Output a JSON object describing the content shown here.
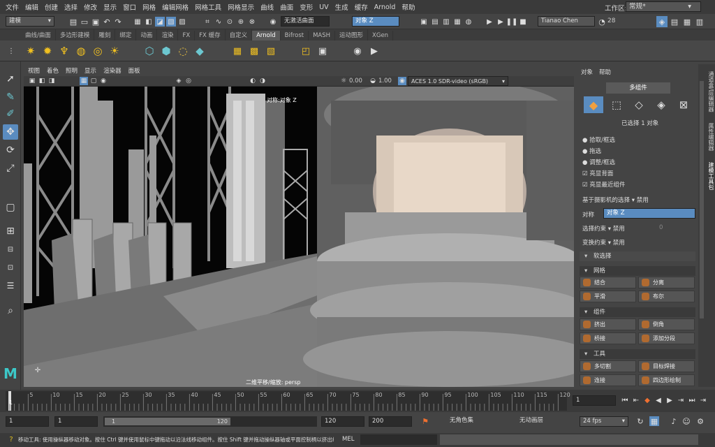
{
  "menubar": {
    "items": [
      "文件",
      "编辑",
      "创建",
      "选择",
      "修改",
      "显示",
      "窗口",
      "网格",
      "编辑网格",
      "网格工具",
      "网格显示",
      "曲线",
      "曲面",
      "变形",
      "UV",
      "生成",
      "缓存",
      "Arnold",
      "帮助"
    ],
    "workspace_label": "工作区:",
    "workspace_value": "常规*"
  },
  "statusline": {
    "mode_dropdown": "建模",
    "live_surface": "无激活曲面",
    "symmetry_field": "对象 Z",
    "user": "Tianao Chen",
    "notifications": "28"
  },
  "shelf": {
    "tabs": [
      "曲线/曲面",
      "多边形建模",
      "雕刻",
      "绑定",
      "动画",
      "渲染",
      "FX",
      "FX 缓存",
      "自定义",
      "Arnold",
      "Bifrost",
      "MASH",
      "运动图形",
      "XGen"
    ],
    "active_tab": "Arnold"
  },
  "viewport": {
    "menus": [
      "视图",
      "着色",
      "照明",
      "显示",
      "渲染器",
      "面板"
    ],
    "exposure": "0.00",
    "gamma": "1.00",
    "color_space": "ACES 1.0 SDR-video (sRGB)",
    "hud_top": "对称:对象 Z",
    "hud_bottom": "二维平移/缩放: persp"
  },
  "attr": {
    "menus": [
      "对象",
      "帮助"
    ],
    "component_tab": "多组件",
    "selected_text": "已选择 1 对象",
    "options": [
      "拾取/框选",
      "拖选",
      "调整/框选"
    ],
    "checks": [
      "亮显背面",
      "亮显最近组件"
    ],
    "camera_based": "基于摄影机的选择",
    "disabled": "禁用",
    "symmetry_label": "对称",
    "symmetry_value": "对象 Z",
    "sel_constraint": "选择约束",
    "xform_constraint": "变换约束",
    "zero": "0",
    "soft_select": "软选择",
    "mesh_section": "网格",
    "mesh_btns": [
      "结合",
      "分离",
      "平滑",
      "布尔"
    ],
    "comp_section": "组件",
    "comp_btns": [
      "挤出",
      "倒角",
      "桥接",
      "添加分段"
    ],
    "tool_section": "工具",
    "tool_btns": [
      "多切割",
      "目标焊接",
      "连接",
      "四边形绘制"
    ]
  },
  "rightstrip": {
    "tabs": [
      "建模工具包",
      "属性编辑器",
      "通道盒/层编辑器"
    ]
  },
  "timeline": {
    "ticks": [
      "5",
      "10",
      "15",
      "20",
      "25",
      "30",
      "35",
      "40",
      "45",
      "50",
      "55",
      "60",
      "65",
      "70",
      "75",
      "80",
      "85",
      "90",
      "95",
      "100",
      "105",
      "110",
      "115",
      "120"
    ],
    "start_marker": "1",
    "current_frame": "1"
  },
  "range": {
    "start": "1",
    "anim_start": "1",
    "range_start": "1",
    "range_end": "120",
    "end": "120",
    "anim_end": "200",
    "char_set": "无角色集",
    "anim_layer": "无动画层",
    "fps": "24 fps"
  },
  "cmd": {
    "help": "移动工具: 使用操纵器移动对象。按住 Ctrl 键并使用鼠标中键拖动以沿法线移动组件。按住 Shift 键并拖动操纵器轴或平面控制柄以挤出组件或",
    "mel": "MEL"
  }
}
